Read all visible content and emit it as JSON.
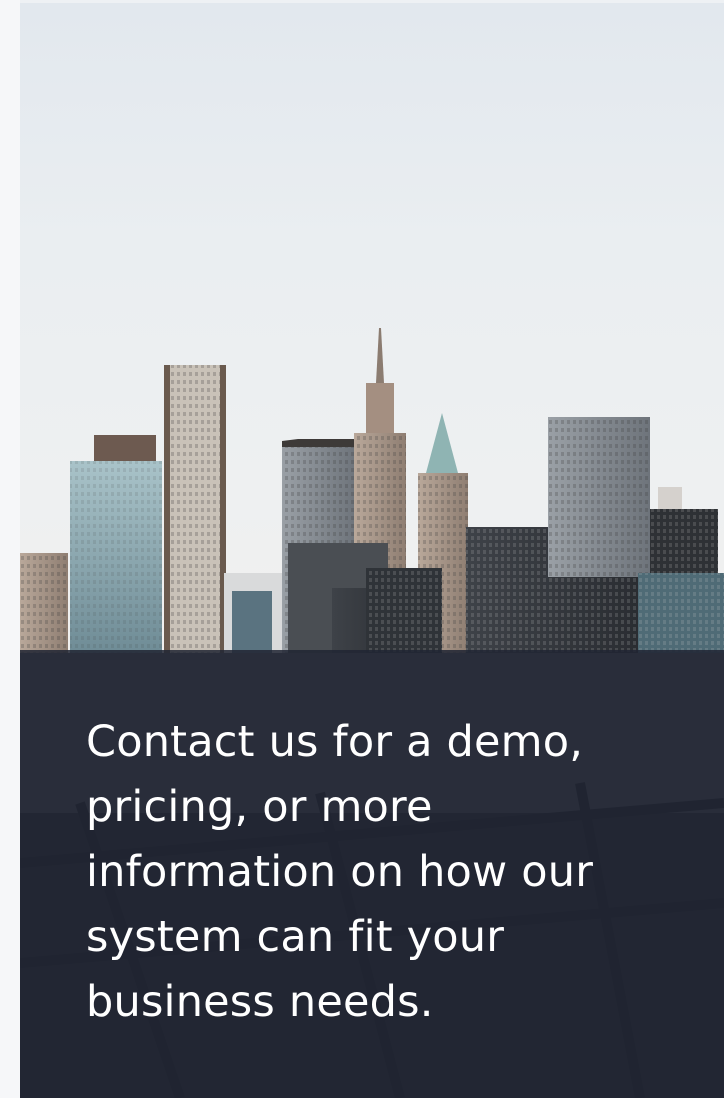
{
  "hero": {
    "image_alt": "city skyline",
    "message": "Contact us for a demo, pricing, or more information on how our system can fit your business needs.",
    "overlay_color": "#212533"
  }
}
